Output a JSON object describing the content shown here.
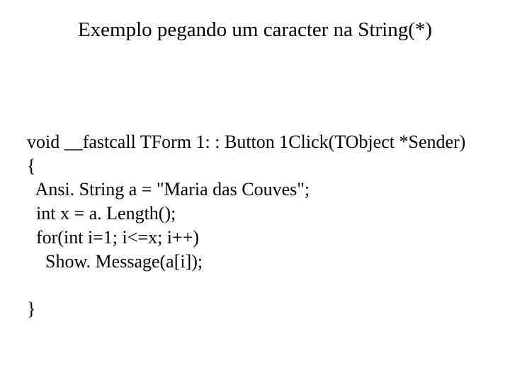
{
  "title": "Exemplo pegando um caracter na String(*)",
  "code": {
    "l1": "void __fastcall TForm 1: : Button 1Click(TObject *Sender)",
    "l2": "{",
    "l3": "  Ansi. String a = \"Maria das Couves\";",
    "l4": "  int x = a. Length();",
    "l5": "  for(int i=1; i<=x; i++)",
    "l6": "    Show. Message(a[i]);",
    "l7": "",
    "l8": "}"
  }
}
